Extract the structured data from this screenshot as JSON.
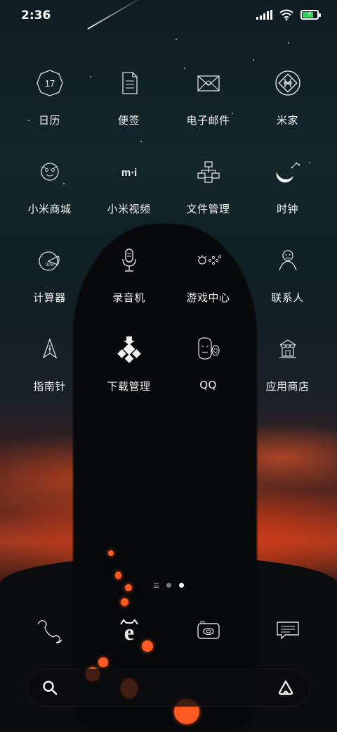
{
  "status_bar": {
    "time": "2:36",
    "icons": [
      "signal-icon",
      "wifi-icon",
      "battery-charging-icon"
    ],
    "battery_color": "#2fd35a"
  },
  "apps": [
    {
      "label": "日历",
      "icon": "calendar-icon",
      "icon_text": "17"
    },
    {
      "label": "便签",
      "icon": "notes-icon"
    },
    {
      "label": "电子邮件",
      "icon": "email-icon"
    },
    {
      "label": "米家",
      "icon": "mijia-icon"
    },
    {
      "label": "小米商城",
      "icon": "mi-store-icon"
    },
    {
      "label": "小米视频",
      "icon": "mi-video-icon"
    },
    {
      "label": "文件管理",
      "icon": "file-manager-icon"
    },
    {
      "label": "时钟",
      "icon": "clock-icon"
    },
    {
      "label": "计算器",
      "icon": "calculator-icon"
    },
    {
      "label": "录音机",
      "icon": "recorder-icon"
    },
    {
      "label": "游戏中心",
      "icon": "game-center-icon"
    },
    {
      "label": "联系人",
      "icon": "contacts-icon"
    },
    {
      "label": "指南针",
      "icon": "compass-icon"
    },
    {
      "label": "下载管理",
      "icon": "download-manager-icon"
    },
    {
      "label": "QQ",
      "icon": "qq-icon"
    },
    {
      "label": "应用商店",
      "icon": "app-store-icon"
    }
  ],
  "page_indicator": {
    "pages": 2,
    "active_page": 2
  },
  "dock": [
    "phone-icon",
    "browser-icon",
    "camera-icon",
    "messages-icon"
  ],
  "search_bar": {
    "left_icon": "search-icon",
    "right_icon": "assistant-icon"
  }
}
